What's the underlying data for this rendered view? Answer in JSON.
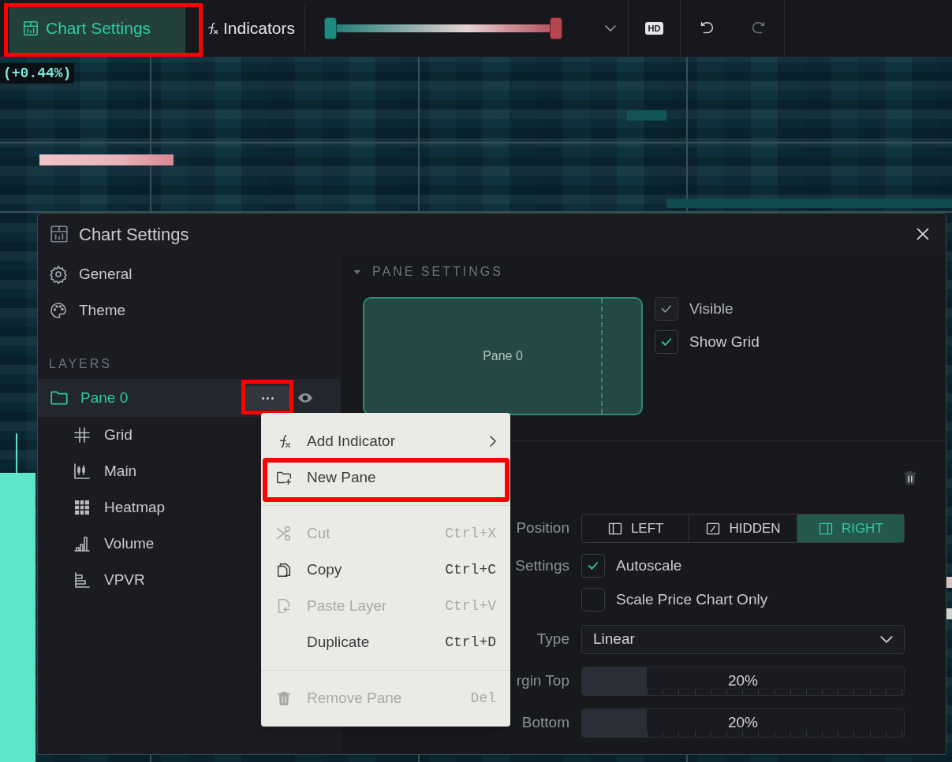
{
  "toolbar": {
    "chart_settings": {
      "label": "Chart Settings",
      "selected": true,
      "marked": true
    },
    "indicators": {
      "label": "Indicators",
      "selected": false
    },
    "color_range": {
      "handles": [
        {
          "level": 0
        },
        {
          "level": 1
        }
      ]
    },
    "hd_badge": "HD"
  },
  "chart": {
    "change_label": "(+0.44%)"
  },
  "dialog": {
    "title": "Chart Settings",
    "nav": [
      {
        "label": "General",
        "kind": "gear"
      },
      {
        "label": "Theme",
        "kind": "palette"
      }
    ],
    "layers_heading": "LAYERS",
    "layers": [
      {
        "label": "Pane 0",
        "selected": true,
        "menu_marked": true,
        "children": [
          {
            "label": "Grid",
            "kind": "grid"
          },
          {
            "label": "Main",
            "kind": "candles"
          },
          {
            "label": "Heatmap",
            "kind": "heatmap"
          },
          {
            "label": "Volume",
            "kind": "volume"
          },
          {
            "label": "VPVR",
            "kind": "vpvr"
          }
        ]
      }
    ],
    "section_heading": "PANE SETTINGS",
    "pane_preview": "Pane 0",
    "pane_checkboxes": [
      {
        "label": "Visible",
        "checked": true,
        "disabled": true
      },
      {
        "label": "Show Grid",
        "checked": true,
        "disabled": false
      }
    ],
    "position": {
      "label": "Position",
      "options": [
        {
          "label": "LEFT",
          "kind": "left",
          "selected": false
        },
        {
          "label": "HIDDEN",
          "kind": "hidden",
          "selected": false
        },
        {
          "label": "RIGHT",
          "kind": "right",
          "selected": true
        }
      ]
    },
    "scale": {
      "label": "Settings",
      "checkboxes": [
        {
          "label": "Autoscale",
          "checked": true
        },
        {
          "label": "Scale Price Chart Only",
          "checked": false
        }
      ]
    },
    "type": {
      "label": "Type",
      "value": "Linear"
    },
    "margins": [
      {
        "label": "rgin Top",
        "value": "20%",
        "level": 0.2
      },
      {
        "label": "Bottom",
        "value": "20%",
        "level": 0.2
      }
    ]
  },
  "context_menu": {
    "items": [
      {
        "kind": "indicator",
        "label": "Add Indicator",
        "submenu": true,
        "disabled": false,
        "marked": false
      },
      {
        "kind": "new-pane",
        "label": "New Pane",
        "submenu": false,
        "disabled": false,
        "marked": true
      },
      {
        "kind": "separator"
      },
      {
        "kind": "cut",
        "label": "Cut",
        "shortcut": "Ctrl+X",
        "disabled": true,
        "marked": false
      },
      {
        "kind": "copy",
        "label": "Copy",
        "shortcut": "Ctrl+C",
        "disabled": false,
        "marked": false
      },
      {
        "kind": "paste",
        "label": "Paste Layer",
        "shortcut": "Ctrl+V",
        "disabled": true,
        "marked": false
      },
      {
        "kind": "duplicate",
        "label": "Duplicate",
        "shortcut": "Ctrl+D",
        "disabled": false,
        "marked": false
      },
      {
        "kind": "separator"
      },
      {
        "kind": "remove",
        "label": "Remove Pane",
        "shortcut": "Del",
        "disabled": true,
        "marked": false
      }
    ]
  }
}
